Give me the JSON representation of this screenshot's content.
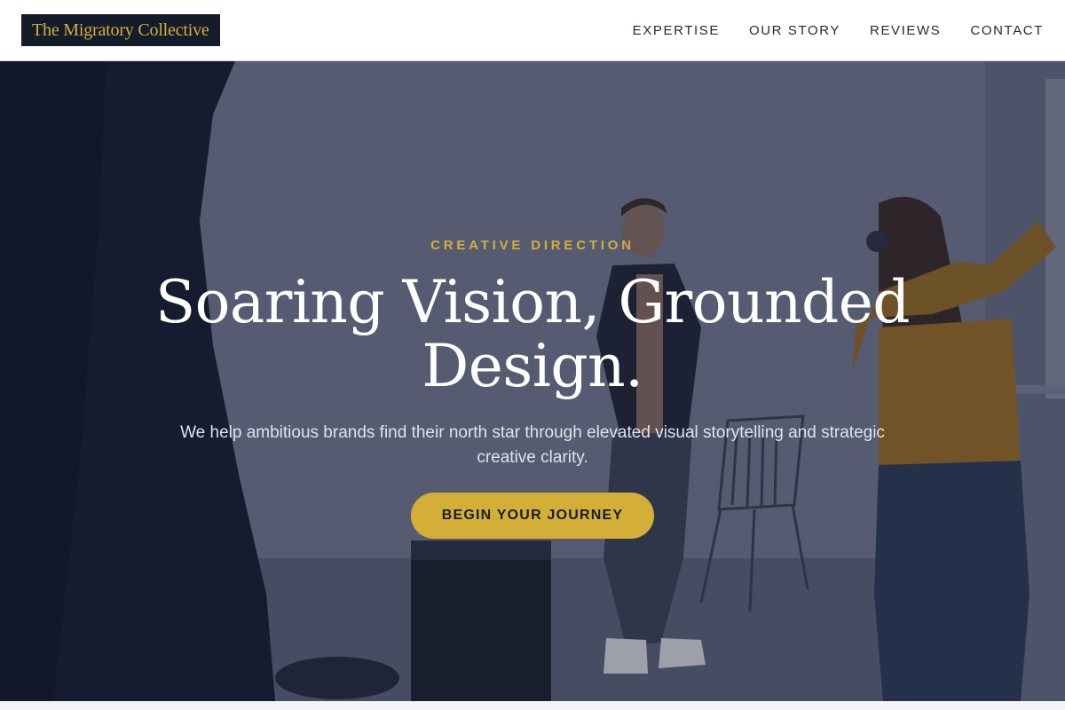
{
  "header": {
    "logo_text": "The Migratory Collective",
    "nav": [
      {
        "label": "EXPERTISE"
      },
      {
        "label": "OUR STORY"
      },
      {
        "label": "REVIEWS"
      },
      {
        "label": "CONTACT"
      }
    ]
  },
  "hero": {
    "eyebrow": "CREATIVE DIRECTION",
    "headline": "Soaring Vision, Grounded Design.",
    "subtext": "We help ambitious brands find their north star through elevated visual storytelling and strategic creative clarity.",
    "cta_label": "BEGIN YOUR JOURNEY",
    "background_image": "photo studio scene with model posing and photographer"
  },
  "colors": {
    "brand_navy": "#141c2c",
    "accent_gold": "#d4af37",
    "nav_text": "#232a36",
    "headline_white": "#ffffff"
  }
}
